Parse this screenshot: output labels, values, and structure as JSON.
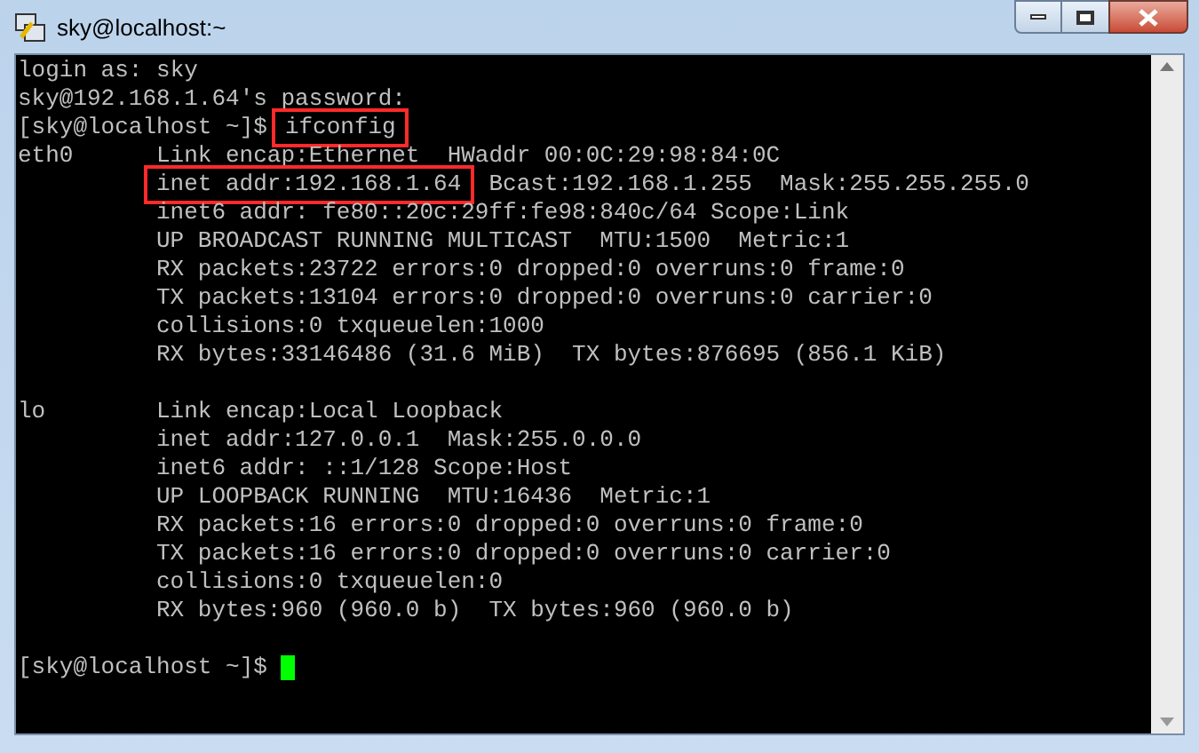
{
  "window": {
    "title": "sky@localhost:~"
  },
  "terminal": {
    "lines": [
      {
        "kind": "text",
        "segments": [
          {
            "text": "login as: sky",
            "highlighted": false
          }
        ]
      },
      {
        "kind": "text",
        "segments": [
          {
            "text": "sky@192.168.1.64's password:",
            "highlighted": false
          }
        ]
      },
      {
        "kind": "text",
        "segments": [
          {
            "text": "[sky@localhost ~]$",
            "highlighted": false
          },
          {
            "text": "ifconfig",
            "highlighted": true
          }
        ]
      },
      {
        "kind": "text",
        "label": "eth0",
        "segments": [
          {
            "text": "Link encap:Ethernet  HWaddr 00:0C:29:98:84:0C",
            "highlighted": false
          }
        ]
      },
      {
        "kind": "text",
        "segments": [
          {
            "text": "inet addr:192.168.1.64",
            "highlighted": true
          },
          {
            "text": "Bcast:192.168.1.255  Mask:255.255.255.0",
            "highlighted": false
          }
        ]
      },
      {
        "kind": "text",
        "segments": [
          {
            "text": "inet6 addr: fe80::20c:29ff:fe98:840c/64 Scope:Link",
            "highlighted": false
          }
        ]
      },
      {
        "kind": "text",
        "segments": [
          {
            "text": "UP BROADCAST RUNNING MULTICAST  MTU:1500  Metric:1",
            "highlighted": false
          }
        ]
      },
      {
        "kind": "text",
        "segments": [
          {
            "text": "RX packets:23722 errors:0 dropped:0 overruns:0 frame:0",
            "highlighted": false
          }
        ]
      },
      {
        "kind": "text",
        "segments": [
          {
            "text": "TX packets:13104 errors:0 dropped:0 overruns:0 carrier:0",
            "highlighted": false
          }
        ]
      },
      {
        "kind": "text",
        "segments": [
          {
            "text": "collisions:0 txqueuelen:1000",
            "highlighted": false
          }
        ]
      },
      {
        "kind": "text",
        "segments": [
          {
            "text": "RX bytes:33146486 (31.6 MiB)  TX bytes:876695 (856.1 KiB)",
            "highlighted": false
          }
        ]
      },
      {
        "kind": "blank"
      },
      {
        "kind": "text",
        "label": "lo",
        "segments": [
          {
            "text": "Link encap:Local Loopback",
            "highlighted": false
          }
        ]
      },
      {
        "kind": "text",
        "segments": [
          {
            "text": "inet addr:127.0.0.1  Mask:255.0.0.0",
            "highlighted": false
          }
        ]
      },
      {
        "kind": "text",
        "segments": [
          {
            "text": "inet6 addr: ::1/128 Scope:Host",
            "highlighted": false
          }
        ]
      },
      {
        "kind": "text",
        "segments": [
          {
            "text": "UP LOOPBACK RUNNING  MTU:16436  Metric:1",
            "highlighted": false
          }
        ]
      },
      {
        "kind": "text",
        "segments": [
          {
            "text": "RX packets:16 errors:0 dropped:0 overruns:0 frame:0",
            "highlighted": false
          }
        ]
      },
      {
        "kind": "text",
        "segments": [
          {
            "text": "TX packets:16 errors:0 dropped:0 overruns:0 carrier:0",
            "highlighted": false
          }
        ]
      },
      {
        "kind": "text",
        "segments": [
          {
            "text": "collisions:0 txqueuelen:0",
            "highlighted": false
          }
        ]
      },
      {
        "kind": "text",
        "segments": [
          {
            "text": "RX bytes:960 (960.0 b)  TX bytes:960 (960.0 b)",
            "highlighted": false
          }
        ]
      },
      {
        "kind": "blank"
      },
      {
        "kind": "prompt",
        "segments": [
          {
            "text": "[sky@localhost ~]$",
            "highlighted": false
          }
        ],
        "cursor": true
      }
    ]
  }
}
